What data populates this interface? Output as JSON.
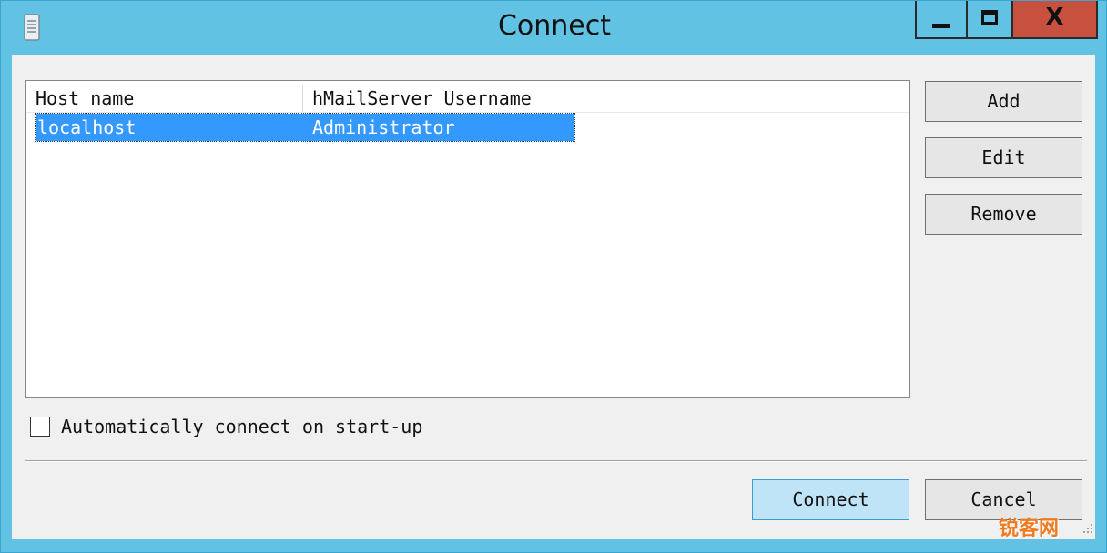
{
  "window": {
    "title": "Connect",
    "icons": {
      "app": "document-icon",
      "minimize": "minimize-icon",
      "maximize": "maximize-icon",
      "close": "close-icon"
    },
    "close_glyph": "X",
    "colors": {
      "titlebar": "#61c2e4",
      "close": "#c7503e",
      "selection": "#3399ff",
      "default_button": "#bfe4f8"
    }
  },
  "server_list": {
    "columns": [
      "Host name",
      "hMailServer Username"
    ],
    "rows": [
      {
        "host": "localhost",
        "username": "Administrator",
        "selected": true
      }
    ]
  },
  "buttons": {
    "add": "Add",
    "edit": "Edit",
    "remove": "Remove",
    "connect": "Connect",
    "cancel": "Cancel"
  },
  "auto_connect": {
    "label": "Automatically connect on start-up",
    "checked": false
  },
  "watermark": "锐客网"
}
